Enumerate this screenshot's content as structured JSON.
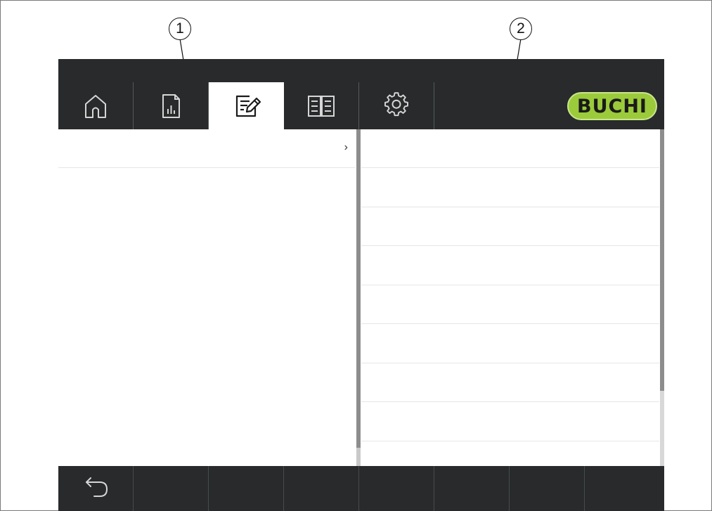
{
  "callouts": [
    {
      "number": "1"
    },
    {
      "number": "2"
    }
  ],
  "topbar": {
    "tabs": [
      {
        "icon": "home-icon",
        "active": false
      },
      {
        "icon": "report-icon",
        "active": false
      },
      {
        "icon": "edit-icon",
        "active": true
      },
      {
        "icon": "manual-icon",
        "active": false
      },
      {
        "icon": "settings-icon",
        "active": false
      }
    ],
    "logo_text": "BUCHI"
  },
  "left_pane": {
    "rows": [
      {
        "label": "",
        "has_chevron": true
      }
    ],
    "chevron_glyph": "›"
  },
  "right_pane": {
    "rows": [
      {
        "label": ""
      },
      {
        "label": ""
      },
      {
        "label": ""
      },
      {
        "label": ""
      },
      {
        "label": ""
      },
      {
        "label": ""
      },
      {
        "label": ""
      },
      {
        "label": ""
      }
    ]
  },
  "bottombar": {
    "buttons": [
      {
        "icon": "back-icon"
      },
      {
        "icon": ""
      },
      {
        "icon": ""
      },
      {
        "icon": ""
      },
      {
        "icon": ""
      },
      {
        "icon": ""
      },
      {
        "icon": ""
      },
      {
        "icon": ""
      }
    ]
  },
  "colors": {
    "bar_background": "#282a2b",
    "logo_green": "#9bcb3b",
    "icon_light": "#d6d6d6",
    "icon_dark": "#1a1a1a"
  }
}
